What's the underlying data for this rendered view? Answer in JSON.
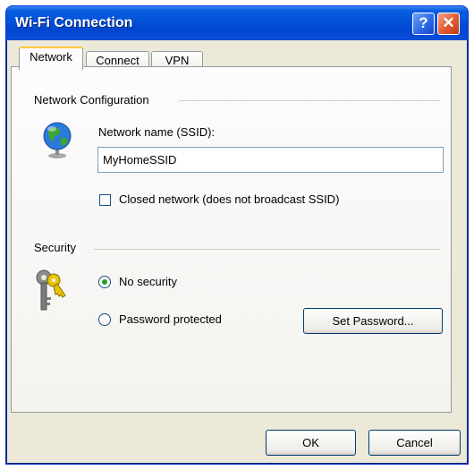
{
  "window": {
    "title": "Wi-Fi Connection"
  },
  "titlebar_buttons": {
    "help": "?",
    "close": "✕"
  },
  "tabs": [
    {
      "label": "Network",
      "active": true
    },
    {
      "label": "Connect",
      "active": false
    },
    {
      "label": "VPN",
      "active": false
    }
  ],
  "network_config": {
    "group_label": "Network Configuration",
    "ssid_label": "Network name (SSID):",
    "ssid_value": "MyHomeSSID",
    "closed_network_label": "Closed network (does not broadcast SSID)",
    "closed_network_checked": false,
    "icon": "globe-icon"
  },
  "security": {
    "group_label": "Security",
    "icon": "keys-icon",
    "options": [
      {
        "label": "No security",
        "selected": true
      },
      {
        "label": "Password protected",
        "selected": false
      }
    ],
    "set_password_label": "Set Password..."
  },
  "footer": {
    "ok_label": "OK",
    "cancel_label": "Cancel"
  }
}
